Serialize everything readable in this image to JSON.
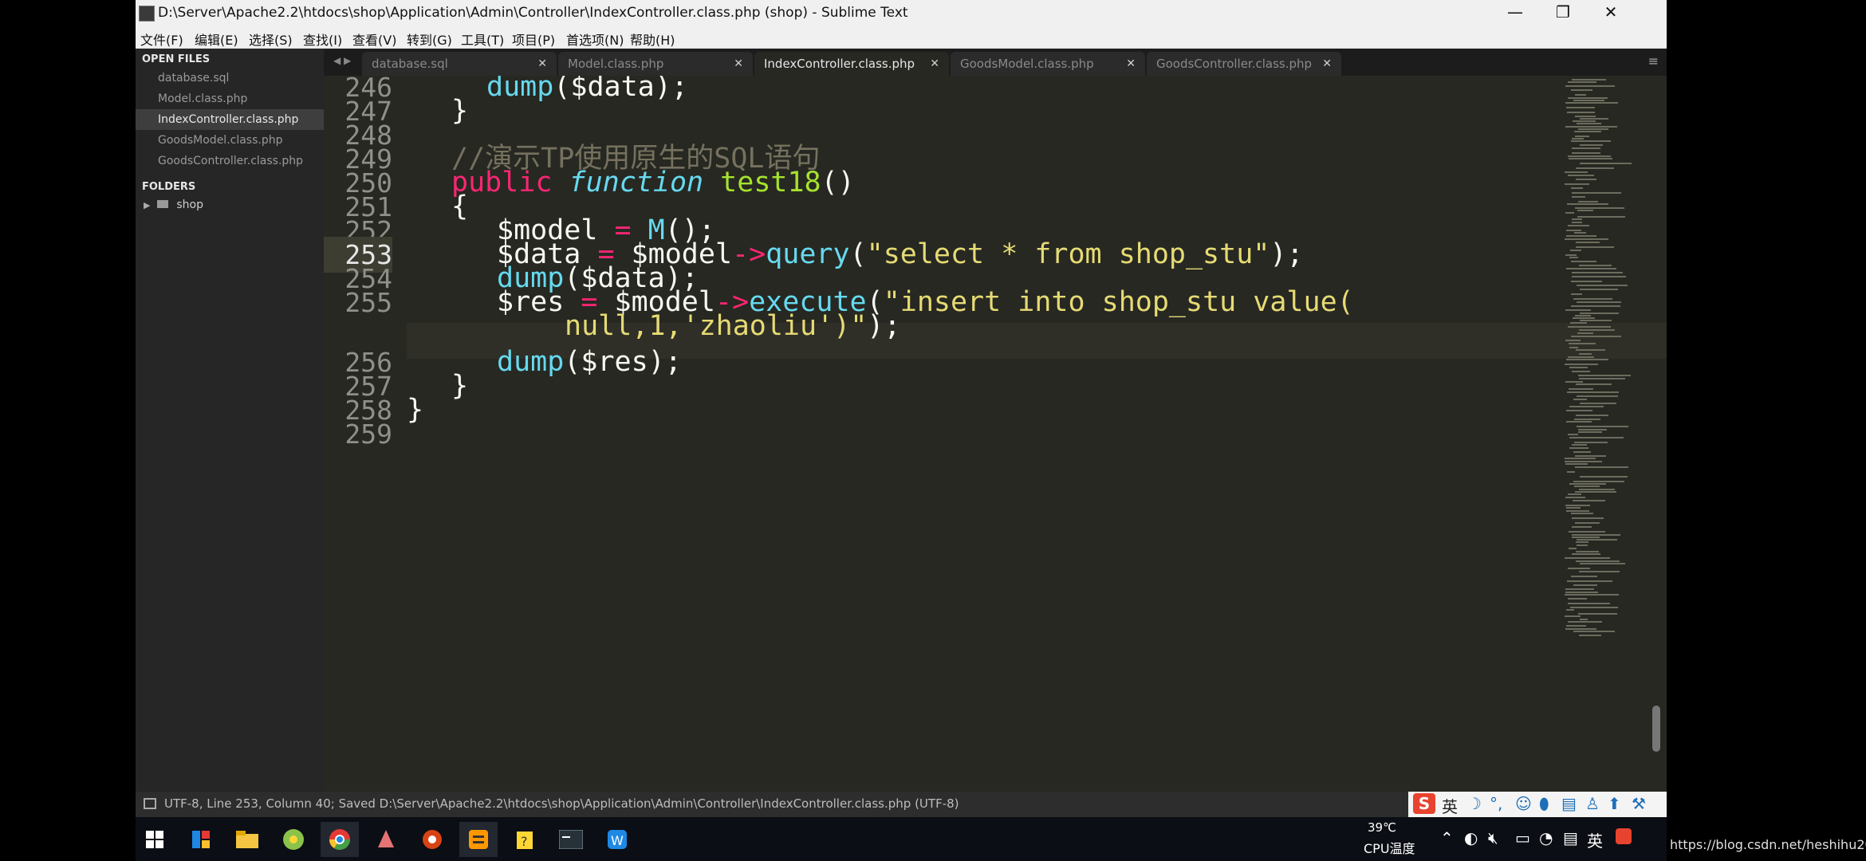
{
  "window": {
    "title": "D:\\Server\\Apache2.2\\htdocs\\shop\\Application\\Admin\\Controller\\IndexController.class.php (shop) - Sublime Text",
    "minimize": "—",
    "maximize": "❐",
    "close": "✕"
  },
  "menu": [
    "文件(F)",
    "编辑(E)",
    "选择(S)",
    "查找(I)",
    "查看(V)",
    "转到(G)",
    "工具(T)",
    "项目(P)",
    "首选项(N)",
    "帮助(H)"
  ],
  "sidebar": {
    "open_files_header": "OPEN FILES",
    "files": [
      "database.sql",
      "Model.class.php",
      "IndexController.class.php",
      "GoodsModel.class.php",
      "GoodsController.class.php"
    ],
    "active_file": "IndexController.class.php",
    "folders_header": "FOLDERS",
    "folder": "shop"
  },
  "tabs": {
    "nav": "◀ ▶",
    "items": [
      "database.sql",
      "Model.class.php",
      "IndexController.class.php",
      "GoodsModel.class.php",
      "GoodsController.class.php"
    ],
    "active": "IndexController.class.php",
    "close_glyph": "✕",
    "menu_glyph": "≡"
  },
  "editor": {
    "current_line": 253,
    "line_numbers": [
      "246",
      "247",
      "248",
      "249",
      "250",
      "251",
      "252",
      "253",
      "254",
      "255",
      "256",
      "257",
      "258",
      "259"
    ],
    "code": {
      "l246": [
        "dump",
        "(",
        "$data",
        ");"
      ],
      "l247": "}",
      "l249": "//演示TP使用原生的SQL语句",
      "l250": [
        "public",
        "function",
        "test18",
        "()"
      ],
      "l251": "{",
      "l252": [
        "$model ",
        "=",
        " ",
        "M",
        "();"
      ],
      "l253": [
        "$data ",
        "=",
        " $model",
        "->",
        "query",
        "(",
        "\"select * from shop_stu\"",
        ");"
      ],
      "l254": [
        "dump",
        "($data);"
      ],
      "l255": [
        "$res ",
        "=",
        " $model",
        "->",
        "execute",
        "(",
        "\"insert into shop_stu value("
      ],
      "l255b": [
        "null,1,'zhaoliu')\"",
        ");"
      ],
      "l256": [
        "dump",
        "($res);"
      ],
      "l257": "}",
      "l258": "}"
    }
  },
  "statusbar": {
    "text": "UTF-8, Line 253, Column 40; Saved D:\\Server\\Apache2.2\\htdocs\\shop\\Application\\Admin\\Controller\\IndexController.class.php (UTF-8)",
    "ime_logo": "S",
    "ime_lang": "英"
  },
  "taskbar": {
    "temp": "39℃",
    "cpu": "CPU温度",
    "lang": "英",
    "icons": [
      "windows-start-icon",
      "app-icon",
      "file-explorer-icon",
      "app-icon",
      "chrome-icon",
      "app-icon",
      "app-icon",
      "sublime-text-icon",
      "app-icon",
      "terminal-icon",
      "app-icon"
    ]
  },
  "watermark": "https://blog.csdn.net/heshihu2019"
}
